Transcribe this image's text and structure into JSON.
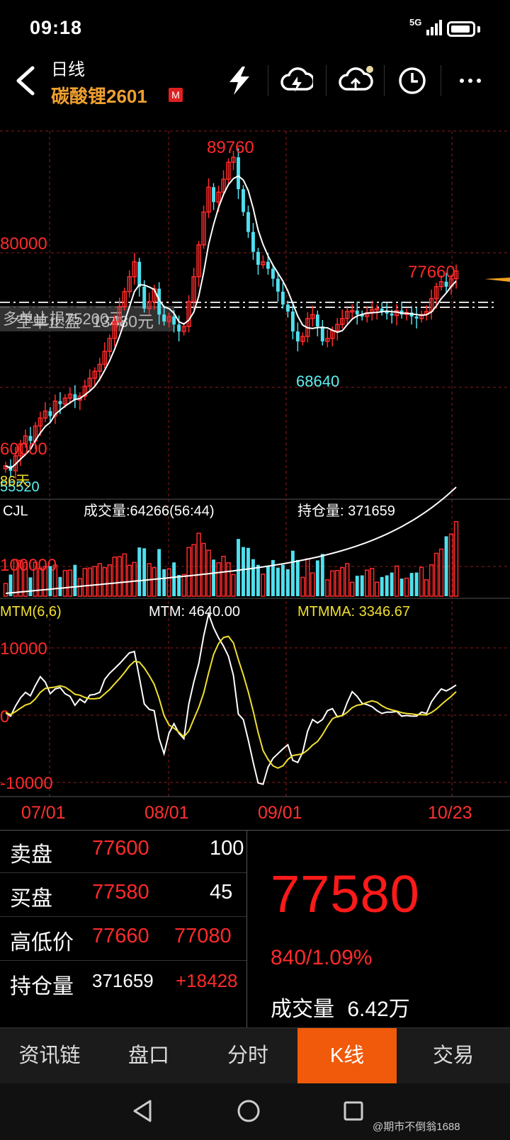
{
  "status_bar": {
    "time": "09:18",
    "network": "5G"
  },
  "header": {
    "period": "日线",
    "symbol": "碳酸锂2601",
    "badge": "M"
  },
  "toolbar_icons": [
    "lightning-icon",
    "cloud-sync-icon",
    "cloud-upload-icon",
    "clock-icon",
    "more-icon"
  ],
  "chart": {
    "price_labels": {
      "high": "89760",
      "low": "68640",
      "recent_high": "77660",
      "level_80000": "80000",
      "level_60000": "60000",
      "bottom": "55520",
      "days": "86天"
    },
    "overlay_text": "多单止损75200元",
    "overlay_text2": "空单止盈",
    "overlay_text3": "13480元",
    "volume": {
      "indicator": "CJL",
      "volume_text": "成交量:64266(56:44)",
      "oi_text": "持仓量: 371659",
      "level": "100000"
    },
    "mtm": {
      "indicator": "MTM(6,6)",
      "mtm_text": "MTM: 4640.00",
      "mtmma_text": "MTMMA: 3346.67",
      "levels": [
        "10000",
        "0",
        "-10000"
      ]
    },
    "dates": [
      "07/01",
      "08/01",
      "09/01",
      "10/23"
    ]
  },
  "chart_data": {
    "type": "candlestick",
    "title": "",
    "price_ylim": [
      55000,
      92000
    ],
    "series": [
      {
        "name": "close",
        "values": [
          58000,
          57500,
          59000,
          60200,
          61000,
          60500,
          62000,
          62800,
          63500,
          63000,
          64500,
          64200,
          64800,
          65200,
          64600,
          65000,
          66000,
          66800,
          67500,
          68200,
          69500,
          70800,
          72500,
          74000,
          75500,
          77000,
          78500,
          76000,
          73800,
          74500,
          75800,
          73200,
          72500,
          73000,
          72200,
          71500,
          72000,
          74500,
          77000,
          80200,
          83500,
          86000,
          84500,
          85500,
          86800,
          88500,
          89000,
          85800,
          83500,
          81500,
          79500,
          78200,
          78500,
          77800,
          76800,
          75500,
          74200,
          73500,
          71500,
          70500,
          71000,
          72800,
          73200,
          72000,
          70500,
          70800,
          71600,
          72200,
          72800,
          73500,
          73600,
          73200,
          73000,
          73400,
          73700,
          73800,
          73500,
          73300,
          73100,
          73600,
          73200,
          73400,
          73000,
          72800,
          73200,
          73500,
          74800,
          76000,
          76500,
          76000,
          76800,
          77580
        ]
      }
    ],
    "volume_level": 100000,
    "mtm_ylim": [
      -12000,
      14000
    ]
  },
  "quote": {
    "ask_label": "卖盘",
    "ask_price": "77600",
    "ask_qty": "100",
    "bid_label": "买盘",
    "bid_price": "77580",
    "bid_qty": "45",
    "hl_label": "高低价",
    "high": "77660",
    "low": "77080",
    "oi_label": "持仓量",
    "oi": "371659",
    "oi_change": "+18428",
    "last_price": "77580",
    "change": "840/1.09%",
    "volume_label": "成交量",
    "volume": "6.42万"
  },
  "tabs": [
    "资讯链",
    "盘口",
    "分时",
    "K线",
    "交易"
  ],
  "watermark": "@期市不倒翁1688"
}
